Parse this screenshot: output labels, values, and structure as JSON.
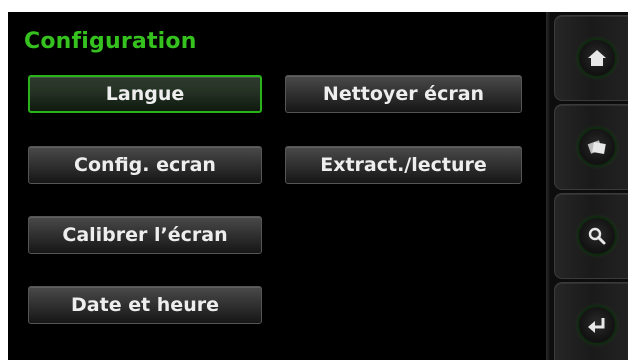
{
  "screen": {
    "title": "Configuration",
    "buttons": {
      "langue": "Langue",
      "nettoyer": "Nettoyer écran",
      "config_ecran": "Config. ecran",
      "extract": "Extract./lecture",
      "calibrer": "Calibrer l’écran",
      "date_heure": "Date et heure"
    },
    "selected": "Langue",
    "accent_color": "#35c21f",
    "sidebar_icons": [
      "home-icon",
      "cards-icon",
      "magnifier-icon",
      "return-icon"
    ]
  }
}
